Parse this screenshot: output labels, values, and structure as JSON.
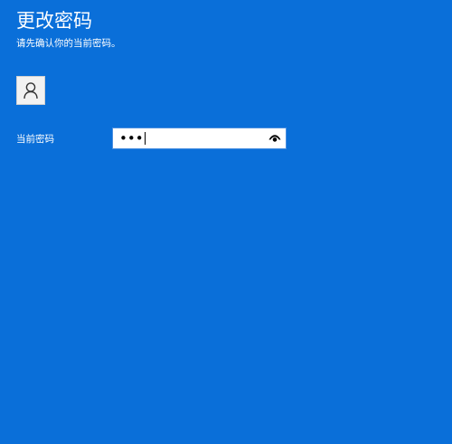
{
  "dialog": {
    "title": "更改密码",
    "subtitle": "请先确认你的当前密码。"
  },
  "user": {
    "avatar_icon": "user-icon"
  },
  "current_password": {
    "label": "当前密码",
    "masked_value": "•••",
    "reveal_icon": "eye-icon"
  },
  "colors": {
    "background": "#0A6FD9",
    "text": "#FFFFFF",
    "field_bg": "#FFFFFF"
  }
}
